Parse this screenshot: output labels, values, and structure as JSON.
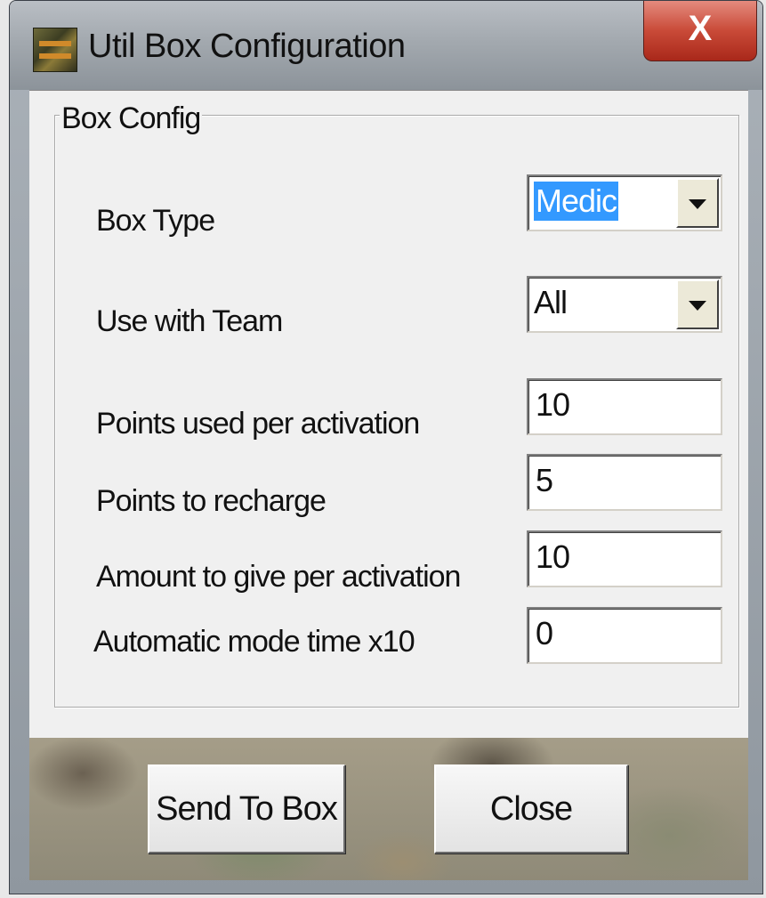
{
  "window": {
    "title": "Util Box Configuration",
    "close_label": "X"
  },
  "group": {
    "label": "Box Config"
  },
  "fields": {
    "box_type": {
      "label": "Box Type",
      "value": "Medic"
    },
    "use_with_team": {
      "label": "Use with Team",
      "value": "All"
    },
    "points_used": {
      "label": "Points used per activation",
      "value": "10"
    },
    "points_recharge": {
      "label": "Points to recharge",
      "value": "5"
    },
    "amount_give": {
      "label": "Amount to give per activation",
      "value": "10"
    },
    "auto_mode": {
      "label": "Automatic mode time x10",
      "value": "0"
    }
  },
  "buttons": {
    "send": "Send To Box",
    "close": "Close"
  },
  "colors": {
    "selection": "#3399ff",
    "close_button": "#c94a38"
  }
}
